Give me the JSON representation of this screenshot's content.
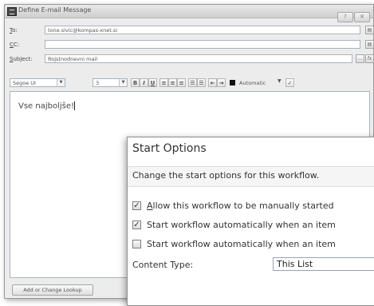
{
  "window": {
    "title": "Define E-mail Message"
  },
  "to": {
    "label": "To:",
    "value": "tone.sivic@kompas-xnet.si"
  },
  "cc": {
    "label": "CC:",
    "value": ""
  },
  "subject": {
    "label": "Subject:",
    "value": "Rojstnodnevni mail",
    "ellipsis_label": "...",
    "fx_label": "fx"
  },
  "format": {
    "font": "Segoe UI",
    "size": "3",
    "color_label": "Automatic"
  },
  "body": {
    "text": "Vse najboljše!"
  },
  "lookup_button": {
    "label": "Add or Change Lookup"
  },
  "start_options": {
    "title": "Start Options",
    "description": "Change the start options for this workflow.",
    "options": [
      {
        "label_u": "A",
        "label": "llow this workflow to be manually started",
        "checked": true
      },
      {
        "label_u": "",
        "label": "Start workflow automatically when an item",
        "checked": true
      },
      {
        "label_u": "",
        "label": "Start workflow automatically when an item",
        "checked": false
      }
    ],
    "content_type_label": "Content Type:",
    "content_type_value": "This List"
  },
  "colors": {
    "window_bg": "#ececec",
    "field_border": "#aab2be"
  }
}
